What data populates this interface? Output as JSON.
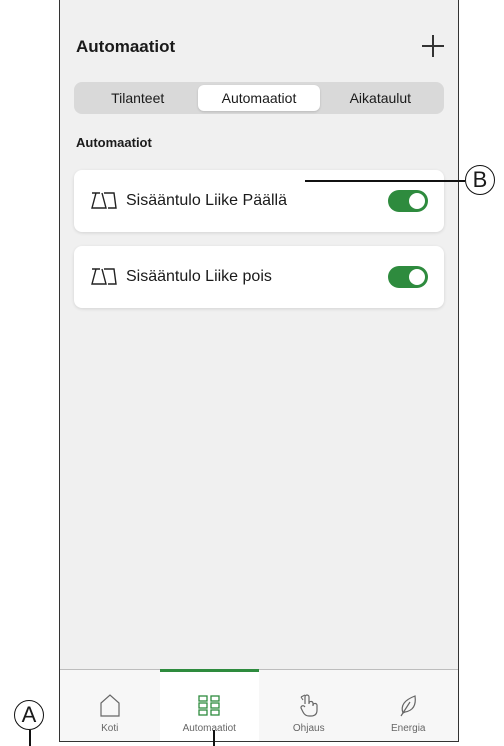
{
  "header": {
    "title": "Automaatiot"
  },
  "segmented": {
    "tabs": [
      {
        "label": "Tilanteet"
      },
      {
        "label": "Automaatiot"
      },
      {
        "label": "Aikataulut"
      }
    ],
    "active_index": 1
  },
  "section_label": "Automaatiot",
  "automations": [
    {
      "label": "Sisääntulo Liike Päällä",
      "enabled": true
    },
    {
      "label": "Sisääntulo Liike pois",
      "enabled": true
    }
  ],
  "tabbar": {
    "items": [
      {
        "label": "Koti",
        "icon": "home-icon"
      },
      {
        "label": "Automaatiot",
        "icon": "grid-icon"
      },
      {
        "label": "Ohjaus",
        "icon": "hand-swipe-icon"
      },
      {
        "label": "Energia",
        "icon": "leaf-icon"
      }
    ],
    "active_index": 1
  },
  "callouts": {
    "a": "A",
    "b": "B"
  },
  "colors": {
    "accent": "#2e8b3e",
    "background": "#f0f0f0"
  }
}
